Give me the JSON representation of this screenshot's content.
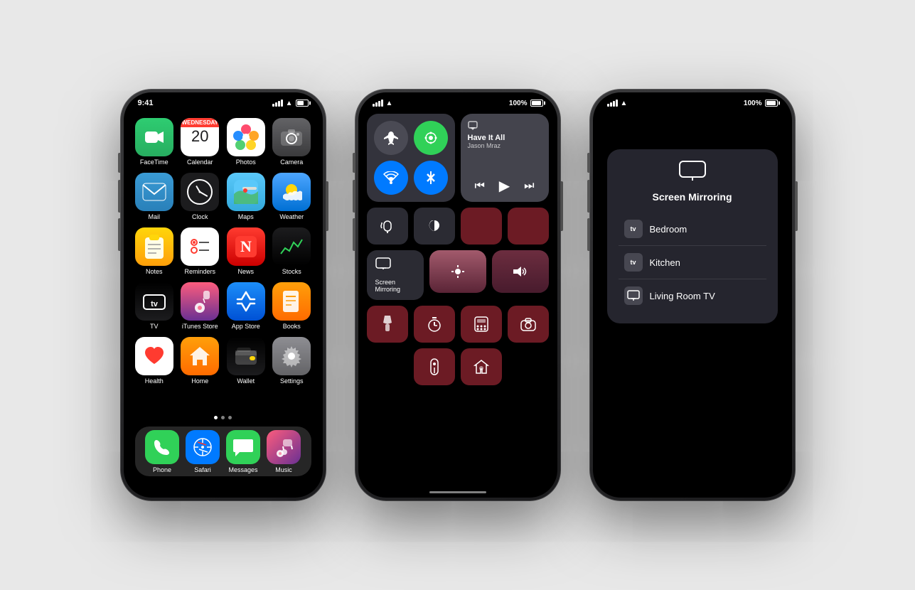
{
  "phones": {
    "phone1": {
      "statusBar": {
        "time": "9:41",
        "signalLabel": "signal",
        "wifiLabel": "wifi",
        "batteryLabel": "battery"
      },
      "apps": [
        {
          "id": "facetime",
          "label": "FaceTime",
          "color": "facetime",
          "emoji": "📹"
        },
        {
          "id": "calendar",
          "label": "Calendar",
          "color": "calendar",
          "day": "Wednesday",
          "date": "20"
        },
        {
          "id": "photos",
          "label": "Photos",
          "color": "photos",
          "emoji": "🌸"
        },
        {
          "id": "camera",
          "label": "Camera",
          "color": "camera",
          "emoji": "📷"
        },
        {
          "id": "mail",
          "label": "Mail",
          "color": "mail",
          "emoji": "✉️"
        },
        {
          "id": "clock",
          "label": "Clock",
          "color": "clock",
          "emoji": "🕐"
        },
        {
          "id": "maps",
          "label": "Maps",
          "color": "maps",
          "emoji": "🗺"
        },
        {
          "id": "weather",
          "label": "Weather",
          "color": "weather",
          "emoji": "🌤"
        },
        {
          "id": "notes",
          "label": "Notes",
          "color": "notes",
          "emoji": "📝"
        },
        {
          "id": "reminders",
          "label": "Reminders",
          "color": "reminders",
          "emoji": "☑️"
        },
        {
          "id": "news",
          "label": "News",
          "color": "news",
          "emoji": "N"
        },
        {
          "id": "stocks",
          "label": "Stocks",
          "color": "stocks",
          "emoji": "📈"
        },
        {
          "id": "tv",
          "label": "TV",
          "color": "tv",
          "emoji": "tv"
        },
        {
          "id": "itunes",
          "label": "iTunes Store",
          "color": "itunes",
          "emoji": "🎵"
        },
        {
          "id": "appstore",
          "label": "App Store",
          "color": "appstore",
          "emoji": "A"
        },
        {
          "id": "books",
          "label": "Books",
          "color": "books",
          "emoji": "📚"
        },
        {
          "id": "health",
          "label": "Health",
          "color": "health",
          "emoji": "❤"
        },
        {
          "id": "home",
          "label": "Home",
          "color": "home",
          "emoji": "🏠"
        },
        {
          "id": "wallet",
          "label": "Wallet",
          "color": "wallet",
          "emoji": "💳"
        },
        {
          "id": "settings",
          "label": "Settings",
          "color": "settings",
          "emoji": "⚙️"
        }
      ],
      "dock": [
        {
          "id": "phone",
          "label": "Phone",
          "emoji": "📞",
          "bg": "#30d158"
        },
        {
          "id": "safari",
          "label": "Safari",
          "emoji": "🧭",
          "bg": "#007aff"
        },
        {
          "id": "messages",
          "label": "Messages",
          "emoji": "💬",
          "bg": "#30d158"
        },
        {
          "id": "music",
          "label": "Music",
          "emoji": "🎵",
          "bg": "#fc5c7d"
        }
      ]
    },
    "phone2": {
      "statusBar": {
        "signal": "●●●",
        "wifi": "wifi",
        "battery": "100%"
      },
      "music": {
        "title": "Have It All",
        "artist": "Jason Mraz"
      },
      "controls": [
        {
          "id": "airplane",
          "label": "Airplane Mode",
          "active": false
        },
        {
          "id": "cellular",
          "label": "Cellular",
          "active": true
        },
        {
          "id": "wifi",
          "label": "WiFi",
          "active": true
        },
        {
          "id": "bluetooth",
          "label": "Bluetooth",
          "active": true
        },
        {
          "id": "orientation",
          "label": "Orientation Lock",
          "active": false
        },
        {
          "id": "donotdisturb",
          "label": "Do Not Disturb",
          "active": false
        },
        {
          "id": "screenmirroring",
          "label": "Screen Mirroring"
        },
        {
          "id": "brightness",
          "label": "Brightness"
        },
        {
          "id": "volume",
          "label": "Volume"
        },
        {
          "id": "flashlight",
          "label": "Flashlight"
        },
        {
          "id": "timer",
          "label": "Timer"
        },
        {
          "id": "calculator",
          "label": "Calculator"
        },
        {
          "id": "camera2",
          "label": "Camera"
        },
        {
          "id": "remote",
          "label": "Remote"
        },
        {
          "id": "homekit",
          "label": "HomeKit"
        }
      ]
    },
    "phone3": {
      "mirroring": {
        "title": "Screen Mirroring",
        "devices": [
          {
            "name": "Bedroom",
            "type": "appletv"
          },
          {
            "name": "Kitchen",
            "type": "appletv"
          },
          {
            "name": "Living Room TV",
            "type": "monitor"
          }
        ]
      }
    }
  }
}
